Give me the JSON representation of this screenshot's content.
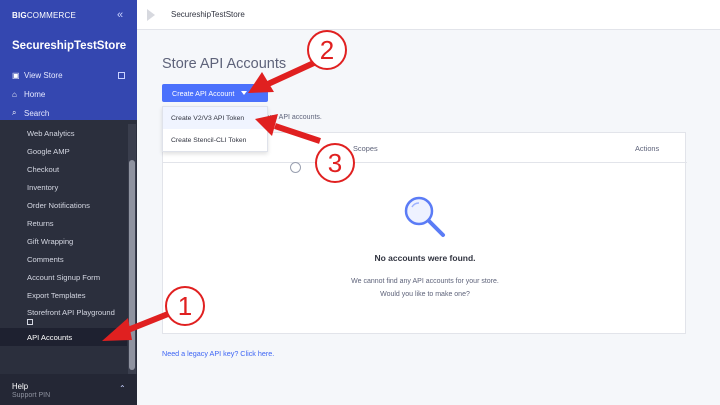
{
  "sidebar": {
    "brand_big": "BIG",
    "brand_commerce": "COMMERCE",
    "store_name": "SecureshipTestStore",
    "top_links": [
      {
        "label": "View Store",
        "icon": "store-icon"
      },
      {
        "label": "Home",
        "icon": "home-icon"
      },
      {
        "label": "Search",
        "icon": "search-icon"
      }
    ],
    "menu_items": [
      "Web Analytics",
      "Google AMP",
      "Checkout",
      "Inventory",
      "Order Notifications",
      "Returns",
      "Gift Wrapping",
      "Comments",
      "Account Signup Form",
      "Export Templates",
      "Storefront API Playground",
      "API Accounts"
    ],
    "help_title": "Help",
    "help_sub": "Support PIN"
  },
  "header": {
    "store_title": "SecureshipTestStore"
  },
  "main": {
    "page_title": "Store API Accounts",
    "create_button": "Create API Account",
    "max_note": "imum API accounts.",
    "dropdown": [
      "Create V2/V3 API Token",
      "Create Stencil-CLI Token"
    ],
    "table": {
      "col_scopes": "Scopes",
      "col_actions": "Actions"
    },
    "empty_title": "No accounts were found.",
    "empty_line1": "We cannot find any API accounts for your store.",
    "empty_line2": "Would you like to make one?",
    "legacy_link": "Need a legacy API key? Click here."
  },
  "annotations": {
    "numbers": [
      "1",
      "2",
      "3"
    ],
    "color": "#e02020"
  },
  "colors": {
    "brand_blue": "#3447b0",
    "sidebar_dark": "#2b2f3d",
    "button_blue": "#4b71fc",
    "link_blue": "#3c64f4"
  }
}
